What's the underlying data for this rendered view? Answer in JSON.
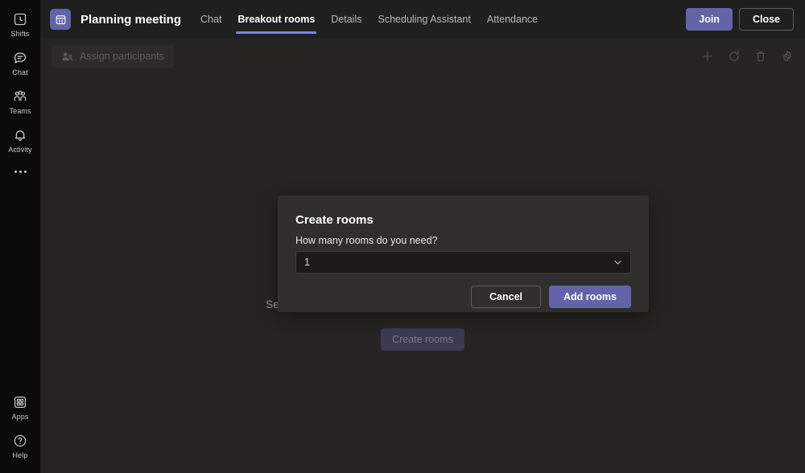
{
  "rail": {
    "items": [
      {
        "label": "Shifts",
        "icon": "shifts-icon"
      },
      {
        "label": "Chat",
        "icon": "chat-icon"
      },
      {
        "label": "Teams",
        "icon": "teams-icon"
      },
      {
        "label": "Activity",
        "icon": "activity-bell-icon"
      }
    ],
    "more": {
      "icon": "more-options-icon"
    },
    "bottom": [
      {
        "label": "Apps",
        "icon": "apps-icon"
      },
      {
        "label": "Help",
        "icon": "help-icon"
      }
    ]
  },
  "header": {
    "app_icon": "calendar-meeting-icon",
    "title": "Planning meeting",
    "tabs": [
      {
        "label": "Chat",
        "active": false
      },
      {
        "label": "Breakout rooms",
        "active": true
      },
      {
        "label": "Details",
        "active": false
      },
      {
        "label": "Scheduling Assistant",
        "active": false
      },
      {
        "label": "Attendance",
        "active": false
      }
    ],
    "join_label": "Join",
    "close_label": "Close",
    "accent_color": "#6264a7",
    "active_tab_underline_color": "#7b83eb"
  },
  "toolbar": {
    "assign_participants_label": "Assign participants",
    "assign_participants_icon": "people-assign-icon",
    "icons": [
      {
        "name": "add-room-icon"
      },
      {
        "name": "recreate-rooms-icon"
      },
      {
        "name": "delete-rooms-icon"
      },
      {
        "name": "rooms-settings-gear-icon"
      }
    ]
  },
  "empty_state": {
    "illustration": "breakout-rooms-illustration",
    "message": "See your rooms and set them up the way you want, all right here.",
    "create_rooms_label": "Create rooms"
  },
  "modal": {
    "title": "Create rooms",
    "field_label": "How many rooms do you need?",
    "rooms_value": "1",
    "dropdown_icon": "chevron-down-icon",
    "cancel_label": "Cancel",
    "add_rooms_label": "Add rooms"
  }
}
